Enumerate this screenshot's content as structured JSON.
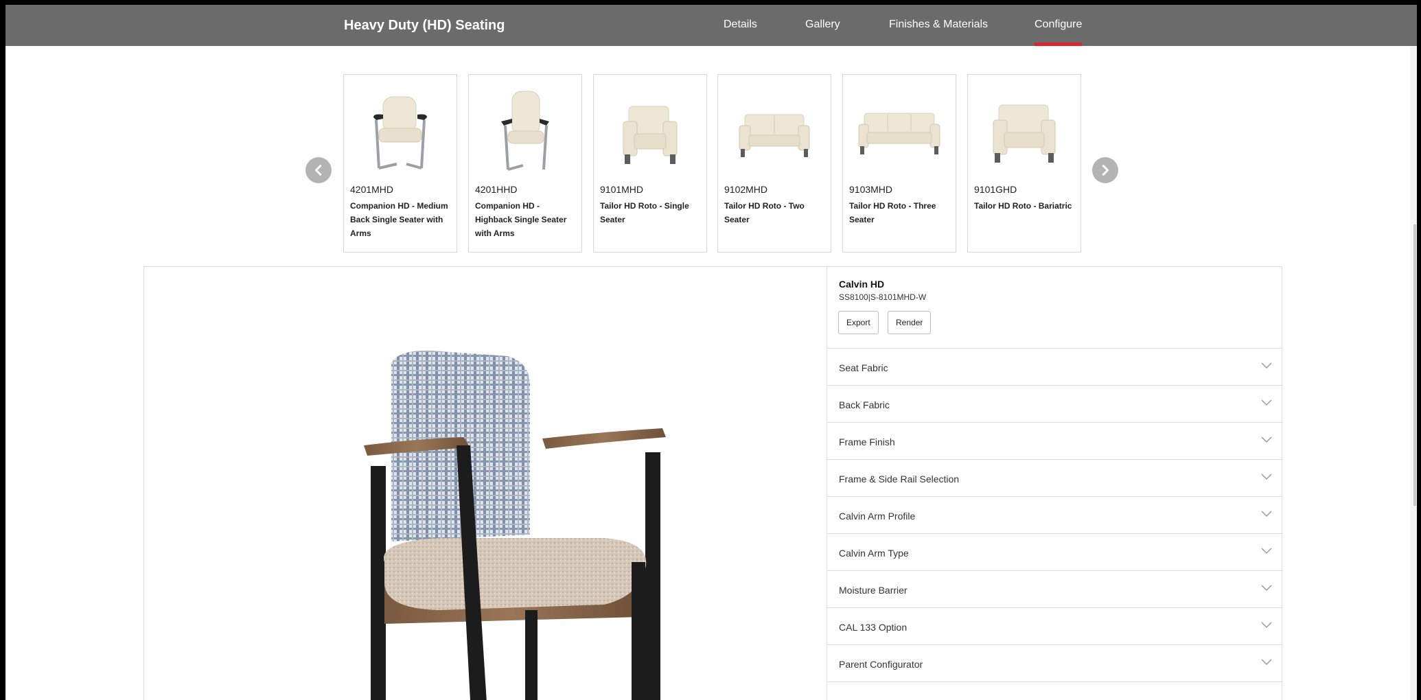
{
  "header": {
    "title": "Heavy Duty (HD) Seating",
    "tabs": [
      {
        "label": "Details"
      },
      {
        "label": "Gallery"
      },
      {
        "label": "Finishes & Materials"
      },
      {
        "label": "Configure"
      }
    ],
    "active_tab": "Configure",
    "accent_color": "#d9262c"
  },
  "carousel": {
    "prev_icon": "chevron-left-icon",
    "next_icon": "chevron-right-icon",
    "items": [
      {
        "sku": "4201MHD",
        "name": "Companion HD - Medium Back Single Seater with Arms"
      },
      {
        "sku": "4201HHD",
        "name": "Companion HD - Highback Single Seater with Arms"
      },
      {
        "sku": "9101MHD",
        "name": "Tailor HD Roto - Single Seater"
      },
      {
        "sku": "9102MHD",
        "name": "Tailor HD Roto - Two Seater"
      },
      {
        "sku": "9103MHD",
        "name": "Tailor HD Roto - Three Seater"
      },
      {
        "sku": "9101GHD",
        "name": "Tailor HD Roto - Bariatric"
      }
    ]
  },
  "configurator": {
    "name": "Calvin HD",
    "code": "SS8100|S-8101MHD-W",
    "export_label": "Export",
    "render_label": "Render",
    "options": [
      {
        "label": "Seat Fabric"
      },
      {
        "label": "Back Fabric"
      },
      {
        "label": "Frame Finish"
      },
      {
        "label": "Frame & Side Rail Selection"
      },
      {
        "label": "Calvin Arm Profile"
      },
      {
        "label": "Calvin Arm Type"
      },
      {
        "label": "Moisture Barrier"
      },
      {
        "label": "CAL 133 Option"
      },
      {
        "label": "Parent Configurator"
      }
    ]
  }
}
